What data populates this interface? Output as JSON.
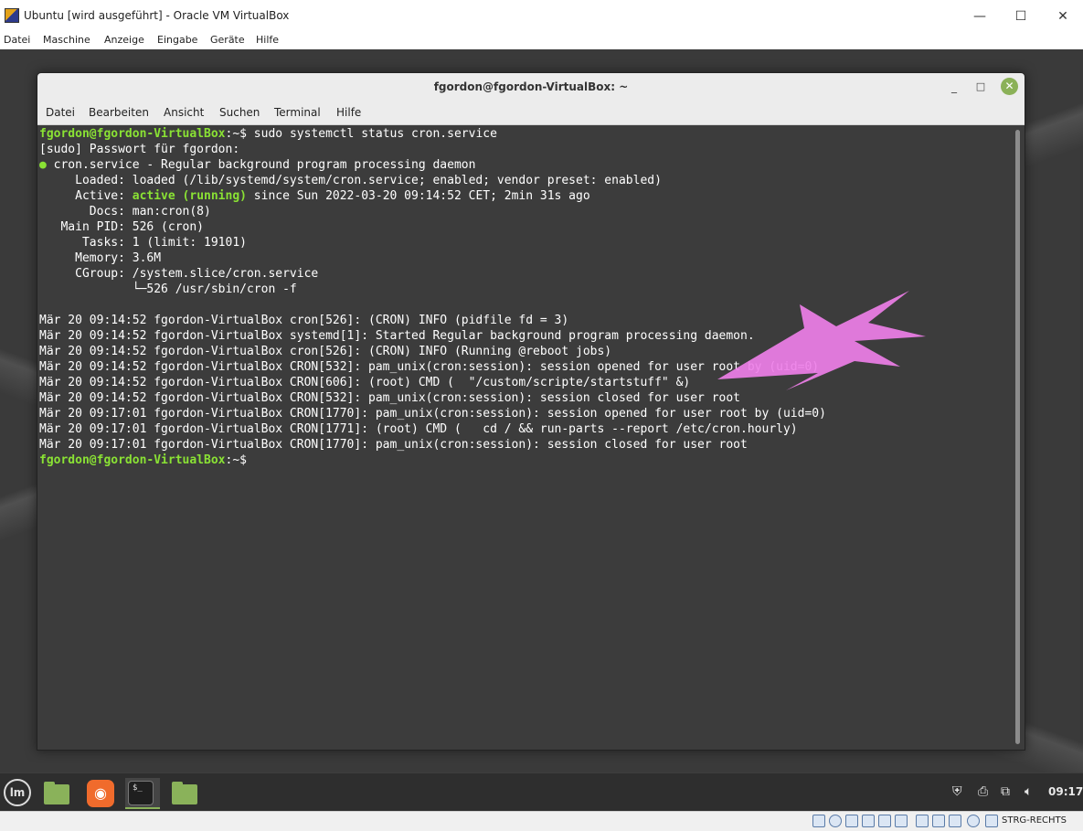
{
  "vbox": {
    "title": "Ubuntu [wird ausgeführt] - Oracle VM VirtualBox",
    "controls": {
      "minimize": "—",
      "maximize": "☐",
      "close": "✕"
    },
    "menu": [
      "Datei",
      "Maschine",
      "Anzeige",
      "Eingabe",
      "Geräte",
      "Hilfe"
    ],
    "host_key": "STRG-RECHTS"
  },
  "terminal": {
    "title": "fgordon@fgordon-VirtualBox: ~",
    "controls": {
      "minimize": "_",
      "maximize": "□",
      "close": "✕"
    },
    "menu": [
      "Datei",
      "Bearbeiten",
      "Ansicht",
      "Suchen",
      "Terminal",
      "Hilfe"
    ],
    "prompt_user": "fgordon@fgordon-VirtualBox",
    "prompt_cwd": ":~$",
    "command": " sudo systemctl status cron.service",
    "lines": [
      "[sudo] Passwort für fgordon:",
      " cron.service - Regular background program processing daemon",
      "     Loaded: loaded (/lib/systemd/system/cron.service; enabled; vendor preset: enabled)",
      "     Active: ",
      "       Docs: man:cron(8)",
      "   Main PID: 526 (cron)",
      "      Tasks: 1 (limit: 19101)",
      "     Memory: 3.6M",
      "     CGroup: /system.slice/cron.service",
      "             └─526 /usr/sbin/cron -f",
      "",
      "Mär 20 09:14:52 fgordon-VirtualBox cron[526]: (CRON) INFO (pidfile fd = 3)",
      "Mär 20 09:14:52 fgordon-VirtualBox systemd[1]: Started Regular background program processing daemon.",
      "Mär 20 09:14:52 fgordon-VirtualBox cron[526]: (CRON) INFO (Running @reboot jobs)",
      "Mär 20 09:14:52 fgordon-VirtualBox CRON[532]: pam_unix(cron:session): session opened for user root by (uid=0)",
      "Mär 20 09:14:52 fgordon-VirtualBox CRON[606]: (root) CMD (  \"/custom/scripte/startstuff\" &)",
      "Mär 20 09:14:52 fgordon-VirtualBox CRON[532]: pam_unix(cron:session): session closed for user root",
      "Mär 20 09:17:01 fgordon-VirtualBox CRON[1770]: pam_unix(cron:session): session opened for user root by (uid=0)",
      "Mär 20 09:17:01 fgordon-VirtualBox CRON[1771]: (root) CMD (   cd / && run-parts --report /etc/cron.hourly)",
      "Mär 20 09:17:01 fgordon-VirtualBox CRON[1770]: pam_unix(cron:session): session closed for user root"
    ],
    "status_dot": "●",
    "active_state": "active (running)",
    "active_rest": " since Sun 2022-03-20 09:14:52 CET; 2min 31s ago"
  },
  "panel": {
    "menu_button_label": "lm",
    "terminal_label": "$_",
    "firefox_glyph": "◉",
    "clock": "09:17",
    "tray": [
      "shield-icon",
      "printer-icon",
      "network-icon",
      "volume-icon"
    ]
  },
  "colors": {
    "prompt_green": "#8ae234",
    "terminal_bg": "#3c3c3c",
    "arrow_pink": "#ee7fe8"
  }
}
